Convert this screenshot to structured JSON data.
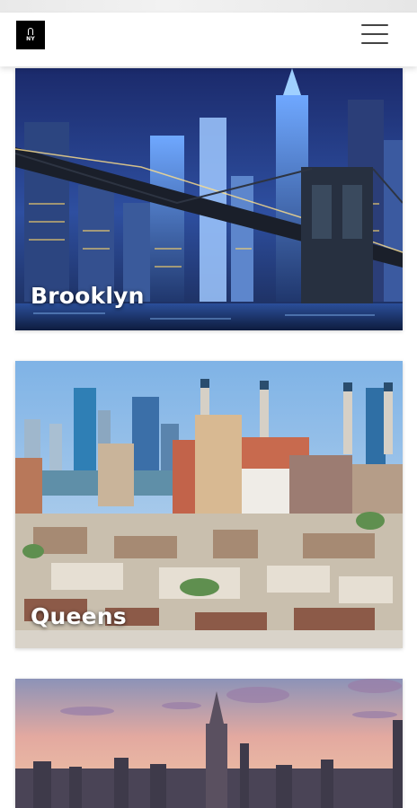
{
  "header": {
    "logo_icon": "logo-icon",
    "menu_icon": "hamburger-menu-icon"
  },
  "cards": [
    {
      "label": "Brooklyn",
      "image_icon": "brooklyn-bridge-night-image"
    },
    {
      "label": "Queens",
      "image_icon": "queens-skyline-image"
    },
    {
      "label": "",
      "image_icon": "manhattan-sunset-skyline-image"
    }
  ],
  "colors": {
    "header_bg": "#ffffff",
    "label_text": "#ffffff",
    "menu_lines": "#444444"
  }
}
